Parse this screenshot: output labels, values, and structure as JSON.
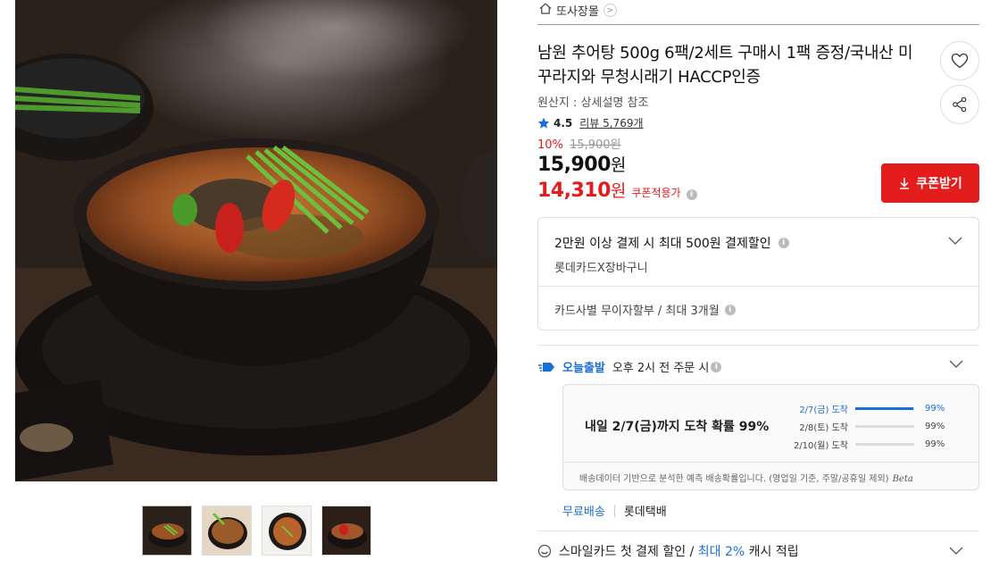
{
  "gallery": {
    "main_image_alt": "",
    "thumbnails": [
      {
        "name": "thumbnail-1",
        "active": true
      },
      {
        "name": "thumbnail-2",
        "active": false
      },
      {
        "name": "thumbnail-3",
        "active": false
      },
      {
        "name": "thumbnail-4",
        "active": false
      }
    ]
  },
  "shop": {
    "name": "또사장몰",
    "chevron": ">"
  },
  "product": {
    "title": "남원 추어탕 500g 6팩/2세트 구매시 1팩 증정/국내산 미꾸라지와 무청시래기 HACCP인증",
    "origin": "원산지 : 상세설명 참조",
    "rating": "4.5",
    "review_label": "리뷰 5,769개",
    "discount_rate": "10%",
    "original_price": "15,900원",
    "price_number": "15,900",
    "price_unit": "원",
    "coupon_price_number": "14,310",
    "coupon_price_unit": "원",
    "coupon_applied_label": "쿠폰적용가"
  },
  "buttons": {
    "wishlist_icon": "heart-icon",
    "share_icon": "share-icon",
    "coupon_label": "쿠폰받기"
  },
  "benefit": {
    "title": "2만원 이상 결제 시 최대 500원 결제할인",
    "subtitle": "롯데카드X장바구니",
    "installment": "카드사별 무이자할부 / 최대 3개월"
  },
  "shipping": {
    "badge": "오늘출발",
    "cutoff": "오후 2시 전 주문 시",
    "main_text": "내일 2/7(금)까지 도착 확률 99%",
    "rows": [
      {
        "date": "2/7(금) 도착",
        "pct": "99%",
        "fraction": 0.99
      },
      {
        "date": "2/8(토) 도착",
        "pct": "99%",
        "fraction": 0.0
      },
      {
        "date": "2/10(월) 도착",
        "pct": "99%",
        "fraction": 0.0
      }
    ],
    "note": "배송데이터 기반으로 분석한 예측 배송확률입니다. (영업일 기준, 주말/공휴일 제외)",
    "note_beta": "Beta",
    "free_label": "무료배송",
    "carrier": "롯데택배"
  },
  "smile": {
    "prefix": "스마일카드 첫 결제 할인 / ",
    "highlight": "최대 2%",
    "suffix": " 캐시 적립"
  },
  "colors": {
    "accent_red": "#e31c1c",
    "accent_blue": "#1a6fd6"
  }
}
